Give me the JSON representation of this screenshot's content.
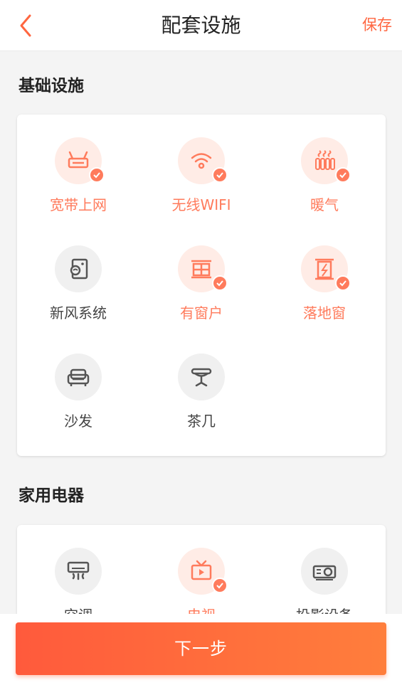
{
  "header": {
    "title": "配套设施",
    "save_label": "保存",
    "back_icon": "chevron-left-icon"
  },
  "colors": {
    "accent": "#ff7b5c",
    "selected_bg": "#ffece6",
    "unselected_bg": "#f0f0f0",
    "button_gradient_start": "#ff5a3c",
    "button_gradient_end": "#ff7e3c"
  },
  "sections": [
    {
      "title": "基础设施",
      "items": [
        {
          "label": "宽带上网",
          "icon": "router-icon",
          "selected": true
        },
        {
          "label": "无线WIFI",
          "icon": "wifi-icon",
          "selected": true
        },
        {
          "label": "暖气",
          "icon": "heater-icon",
          "selected": true
        },
        {
          "label": "新风系统",
          "icon": "fresh-air-icon",
          "selected": false
        },
        {
          "label": "有窗户",
          "icon": "window-icon",
          "selected": true
        },
        {
          "label": "落地窗",
          "icon": "floor-window-icon",
          "selected": true
        },
        {
          "label": "沙发",
          "icon": "sofa-icon",
          "selected": false
        },
        {
          "label": "茶几",
          "icon": "tea-table-icon",
          "selected": false
        }
      ]
    },
    {
      "title": "家用电器",
      "items": [
        {
          "label": "空调",
          "icon": "air-conditioner-icon",
          "selected": false
        },
        {
          "label": "电视",
          "icon": "tv-icon",
          "selected": true
        },
        {
          "label": "投影设备",
          "icon": "projector-icon",
          "selected": false
        }
      ]
    }
  ],
  "footer": {
    "next_label": "下一步"
  }
}
